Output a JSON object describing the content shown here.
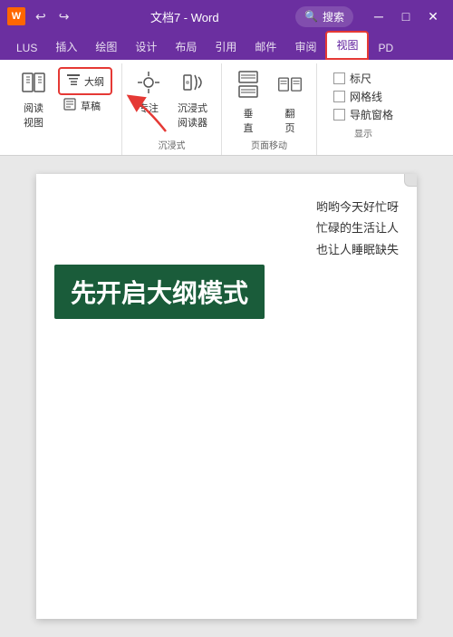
{
  "titleBar": {
    "logo": "W",
    "undoBtn": "↩",
    "redoBtn": "↪",
    "title": "文档7 - Word",
    "searchPlaceholder": "搜索",
    "minimizeIcon": "─",
    "maximizeIcon": "□",
    "closeIcon": "✕"
  },
  "ribbonTabs": [
    {
      "label": "LUS",
      "active": false
    },
    {
      "label": "插入",
      "active": false
    },
    {
      "label": "绘图",
      "active": false
    },
    {
      "label": "设计",
      "active": false
    },
    {
      "label": "布局",
      "active": false
    },
    {
      "label": "引用",
      "active": false
    },
    {
      "label": "邮件",
      "active": false
    },
    {
      "label": "审阅",
      "active": false
    },
    {
      "label": "视图",
      "active": true,
      "highlighted": true
    },
    {
      "label": "PD",
      "active": false
    }
  ],
  "ribbon": {
    "groups": [
      {
        "name": "views",
        "items": [
          {
            "label": "大纲",
            "highlighted": true
          },
          {
            "label": "草稿"
          }
        ],
        "label": ""
      },
      {
        "name": "immersive",
        "items": [
          {
            "label": "专注"
          },
          {
            "label": "沉浸式\n阅读器"
          }
        ],
        "label": "沉浸式"
      },
      {
        "name": "page-move",
        "items": [
          {
            "label": "垂\n直"
          },
          {
            "label": "翻\n页"
          }
        ],
        "label": "页面移动"
      },
      {
        "name": "show",
        "checkboxes": [
          {
            "label": "标尺",
            "checked": false
          },
          {
            "label": "网格线",
            "checked": false
          },
          {
            "label": "导航窗格",
            "checked": false
          }
        ],
        "label": "显示"
      }
    ]
  },
  "document": {
    "textLines": [
      "哟哟今天好忙呀",
      "忙碌的生活让人",
      "也让人睡眠缺失"
    ],
    "highlightBox": "先开启大纲模式"
  }
}
